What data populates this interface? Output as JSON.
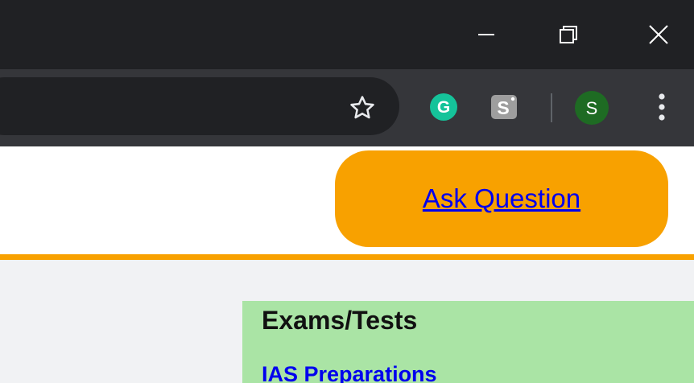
{
  "window": {
    "controls": {
      "minimize_icon": "minimize-icon",
      "restore_icon": "restore-icon",
      "close_icon": "close-icon"
    }
  },
  "toolbar": {
    "bookmark_icon": "star-icon",
    "extensions": [
      {
        "name": "grammarly-icon",
        "letter": "G",
        "color": "#15c39a"
      },
      {
        "name": "s-extension-icon",
        "letter": "S",
        "color": "#9e9e9e"
      }
    ],
    "profile": {
      "letter": "S",
      "color": "#1e6b23"
    },
    "menu_icon": "kebab-menu-icon"
  },
  "header": {
    "ask_question_label": "Ask Question",
    "accent_color": "#f8a100"
  },
  "sidebar": {
    "title": "Exams/Tests",
    "links": [
      "IAS Preparations"
    ],
    "background": "#aae4a5"
  }
}
